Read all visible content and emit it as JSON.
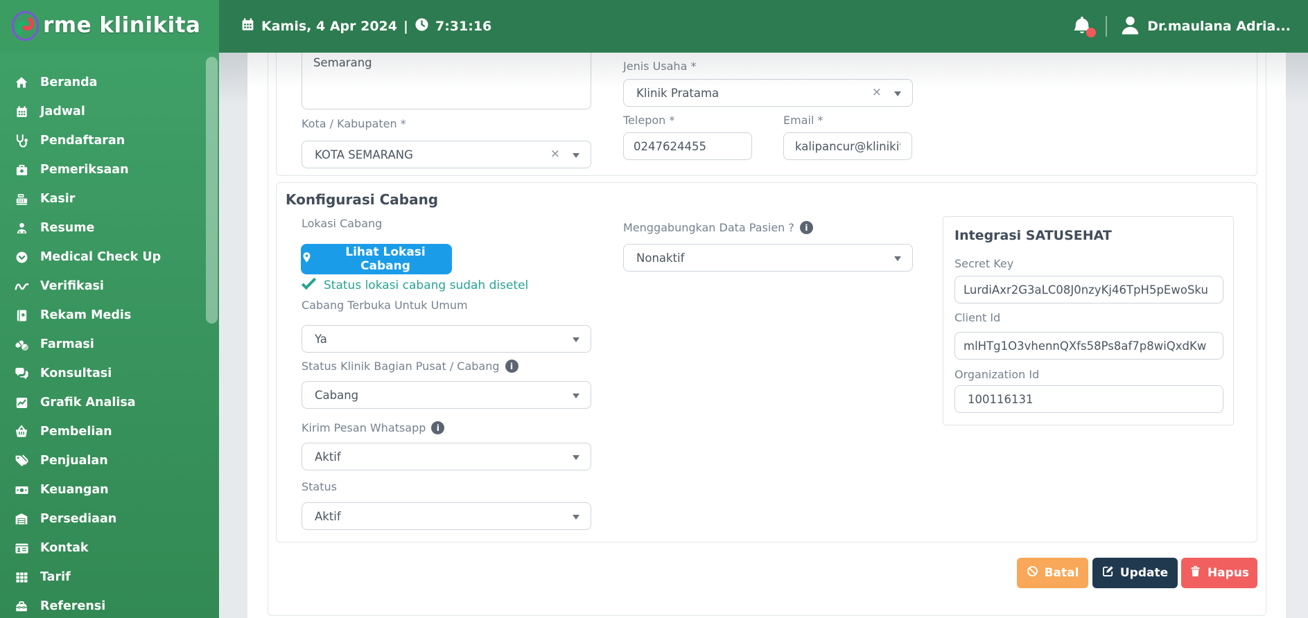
{
  "header": {
    "brand": "rme klinikita",
    "date": "Kamis, 4 Apr 2024",
    "separator": "|",
    "time": "7:31:16",
    "user": "Dr.maulana Adria...",
    "notification_icon": "bell-icon",
    "user_icon": "user-icon"
  },
  "sidebar": {
    "items": [
      {
        "label": "Beranda",
        "icon": "home-icon"
      },
      {
        "label": "Jadwal",
        "icon": "calendar-icon"
      },
      {
        "label": "Pendaftaran",
        "icon": "stethoscope-icon"
      },
      {
        "label": "Pemeriksaan",
        "icon": "briefcase-medical-icon"
      },
      {
        "label": "Kasir",
        "icon": "cash-register-icon"
      },
      {
        "label": "Resume",
        "icon": "user-doctor-icon"
      },
      {
        "label": "Medical Check Up",
        "icon": "circle-chevron-down-icon"
      },
      {
        "label": "Verifikasi",
        "icon": "wave-icon"
      },
      {
        "label": "Rekam Medis",
        "icon": "book-medical-icon"
      },
      {
        "label": "Farmasi",
        "icon": "pills-icon"
      },
      {
        "label": "Konsultasi",
        "icon": "comments-icon"
      },
      {
        "label": "Grafik Analisa",
        "icon": "chart-line-icon"
      },
      {
        "label": "Pembelian",
        "icon": "basket-icon"
      },
      {
        "label": "Penjualan",
        "icon": "tags-icon"
      },
      {
        "label": "Keuangan",
        "icon": "money-icon"
      },
      {
        "label": "Persediaan",
        "icon": "warehouse-icon"
      },
      {
        "label": "Kontak",
        "icon": "id-card-icon"
      },
      {
        "label": "Tarif",
        "icon": "table-icon"
      },
      {
        "label": "Referensi",
        "icon": "toolbox-icon"
      }
    ]
  },
  "form": {
    "alamat": {
      "value": "Semarang"
    },
    "kota": {
      "label": "Kota / Kabupaten *",
      "value": "KOTA SEMARANG"
    },
    "jenis_usaha": {
      "label": "Jenis Usaha *",
      "value": "Klinik Pratama"
    },
    "telepon": {
      "label": "Telepon *",
      "value": "0247624455"
    },
    "email": {
      "label": "Email *",
      "value": "kalipancur@klinikit"
    },
    "konfigurasi": {
      "title": "Konfigurasi Cabang",
      "lokasi_label": "Lokasi Cabang",
      "lokasi_button": "Lihat Lokasi Cabang",
      "lokasi_status": "Status lokasi cabang sudah disetel",
      "terbuka": {
        "label": "Cabang Terbuka Untuk Umum",
        "value": "Ya"
      },
      "status_klinik": {
        "label": "Status Klinik Bagian Pusat / Cabang",
        "value": "Cabang"
      },
      "whatsapp": {
        "label": "Kirim Pesan Whatsapp",
        "value": "Aktif"
      },
      "status": {
        "label": "Status",
        "value": "Aktif"
      },
      "gabung_pasien": {
        "label": "Menggabungkan Data Pasien ?",
        "value": "Nonaktif"
      },
      "info_glyph": "i"
    },
    "satusehat": {
      "title": "Integrasi SATUSEHAT",
      "secret_key": {
        "label": "Secret Key",
        "value": "LurdiAxr2G3aLC08J0nzyKj46TpH5pEwoSku"
      },
      "client_id": {
        "label": "Client Id",
        "value": "mlHTg1O3vhennQXfs58Ps8af7p8wiQxdKw"
      },
      "organization_id": {
        "label": "Organization Id",
        "value": "100116131"
      }
    },
    "actions": {
      "batal": "Batal",
      "update": "Update",
      "hapus": "Hapus"
    },
    "clear_glyph": "×"
  },
  "colors": {
    "header_green": "#2d7b50",
    "brand_green": "#3c9d63",
    "sidebar_green_top": "#3fa067",
    "sidebar_green_bottom": "#328953",
    "accent_blue": "#1b9ce8",
    "success_teal": "#28a392",
    "cancel_orange": "#f8a858",
    "update_navy": "#20394f",
    "delete_red": "#f25f5f",
    "notification_red": "#f05a5a"
  }
}
